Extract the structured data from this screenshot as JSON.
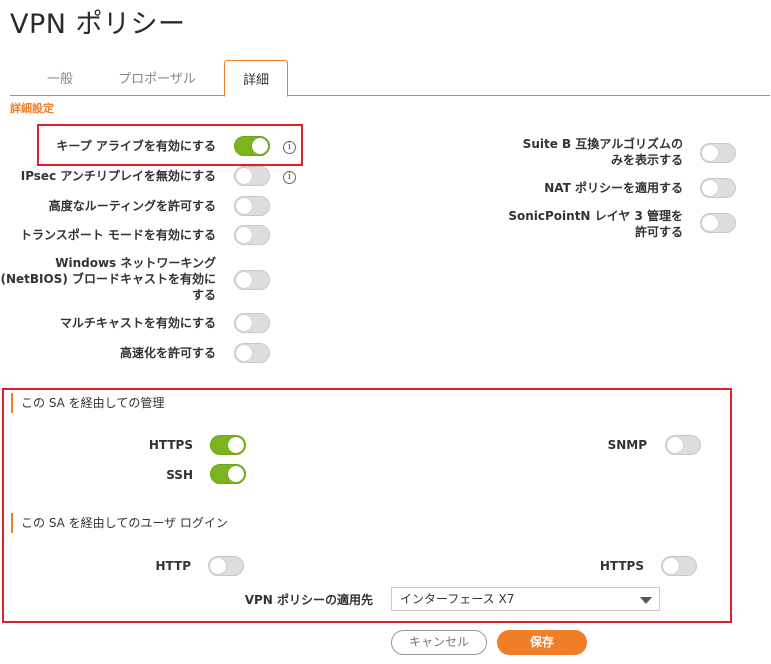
{
  "page": {
    "title": "VPN ポリシー"
  },
  "tabs": [
    {
      "label": "一般"
    },
    {
      "label": "プロポーザル"
    },
    {
      "label": "詳細"
    }
  ],
  "section": {
    "heading": "詳細設定"
  },
  "settings_left": [
    {
      "label": "キープ アライブを有効にする",
      "on": true,
      "info": true
    },
    {
      "label": "IPsec アンチリプレイを無効にする",
      "on": false,
      "info": true
    },
    {
      "label": "高度なルーティングを許可する",
      "on": false
    },
    {
      "label": "トランスポート モードを有効にする",
      "on": false
    },
    {
      "label_line1": "Windows ネットワーキング",
      "label_line2": "(NetBIOS) ブロードキャストを有効に",
      "label_line3": "する",
      "on": false
    },
    {
      "label": "マルチキャストを有効にする",
      "on": false
    },
    {
      "label": "高速化を許可する",
      "on": false
    }
  ],
  "settings_right": [
    {
      "label_line1": "Suite B 互換アルゴリズムの",
      "label_line2": "みを表示する",
      "on": false
    },
    {
      "label": "NAT ポリシーを適用する",
      "on": false
    },
    {
      "label_line1": "SonicPointN レイヤ 3 管理を",
      "label_line2": "許可する",
      "on": false
    }
  ],
  "management": {
    "heading": "この SA を経由しての管理",
    "https": {
      "label": "HTTPS",
      "on": true
    },
    "ssh": {
      "label": "SSH",
      "on": true
    },
    "snmp": {
      "label": "SNMP",
      "on": false
    }
  },
  "user_login": {
    "heading": "この SA を経由してのユーザ ログイン",
    "http": {
      "label": "HTTP",
      "on": false
    },
    "https": {
      "label": "HTTPS",
      "on": false
    }
  },
  "apply_to": {
    "label": "VPN ポリシーの適用先",
    "value": "インターフェース X7"
  },
  "buttons": {
    "cancel": "キャンセル",
    "save": "保存"
  },
  "colors": {
    "accent": "#f07e26",
    "toggle_on": "#7ab51d",
    "highlight_box": "#d9222a"
  }
}
